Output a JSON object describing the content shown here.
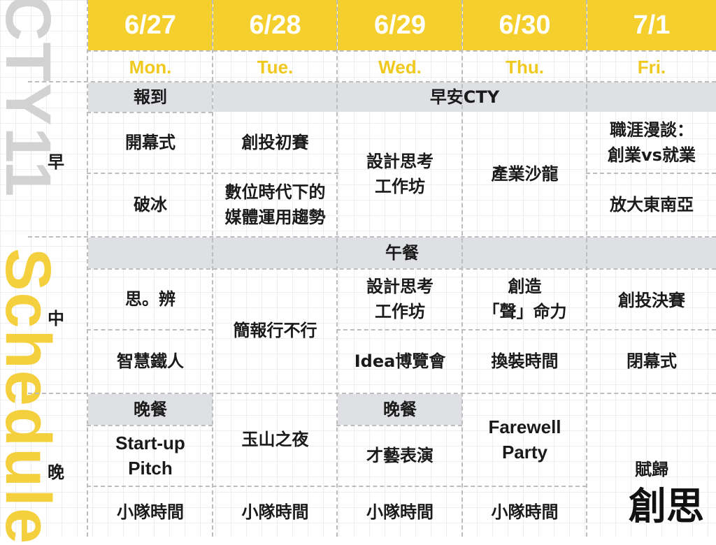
{
  "side": {
    "left_top": "CTY11",
    "left_bottom": "Schedule"
  },
  "days": [
    {
      "date": "6/27",
      "dow": "Mon."
    },
    {
      "date": "6/28",
      "dow": "Tue."
    },
    {
      "date": "6/29",
      "dow": "Wed."
    },
    {
      "date": "6/30",
      "dow": "Thu."
    },
    {
      "date": "7/1",
      "dow": "Fri."
    }
  ],
  "periods": {
    "morning": "早",
    "noon": "中",
    "night": "晚"
  },
  "morning": {
    "checkin": "報到",
    "good_morning": "早安CTY",
    "mon_1": "開幕式",
    "mon_2": "破冰",
    "tue_1": "創投初賽",
    "tue_2": "數位時代下的\n媒體運用趨勢",
    "wed": "設計思考\n工作坊",
    "thu": "產業沙龍",
    "fri_1": "職涯漫談：\n創業vs就業",
    "fri_2": "放大東南亞"
  },
  "lunch": "午餐",
  "noon": {
    "mon_1": "思。辨",
    "mon_2": "智慧鐵人",
    "tue": "簡報行不行",
    "wed_1": "設計思考\n工作坊",
    "wed_2": "Idea博覽會",
    "thu_1": "創造\n「聲」命力",
    "thu_2": "換裝時間",
    "fri_1": "創投決賽",
    "fri_2": "閉幕式"
  },
  "night": {
    "mon_dinner": "晚餐",
    "mon_1": "Start-up\nPitch",
    "mon_2": "小隊時間",
    "tue_1": "玉山之夜",
    "tue_2": "小隊時間",
    "wed_dinner": "晚餐",
    "wed_1": "才藝表演",
    "wed_2": "小隊時間",
    "thu_1": "Farewell\nParty",
    "thu_2": "小隊時間",
    "fri": "賦歸"
  },
  "logo_text": "創思",
  "colors": {
    "accent": "#f5cf2e",
    "gray_band": "#dfe0e3",
    "side_gray": "#d2d2d2"
  }
}
